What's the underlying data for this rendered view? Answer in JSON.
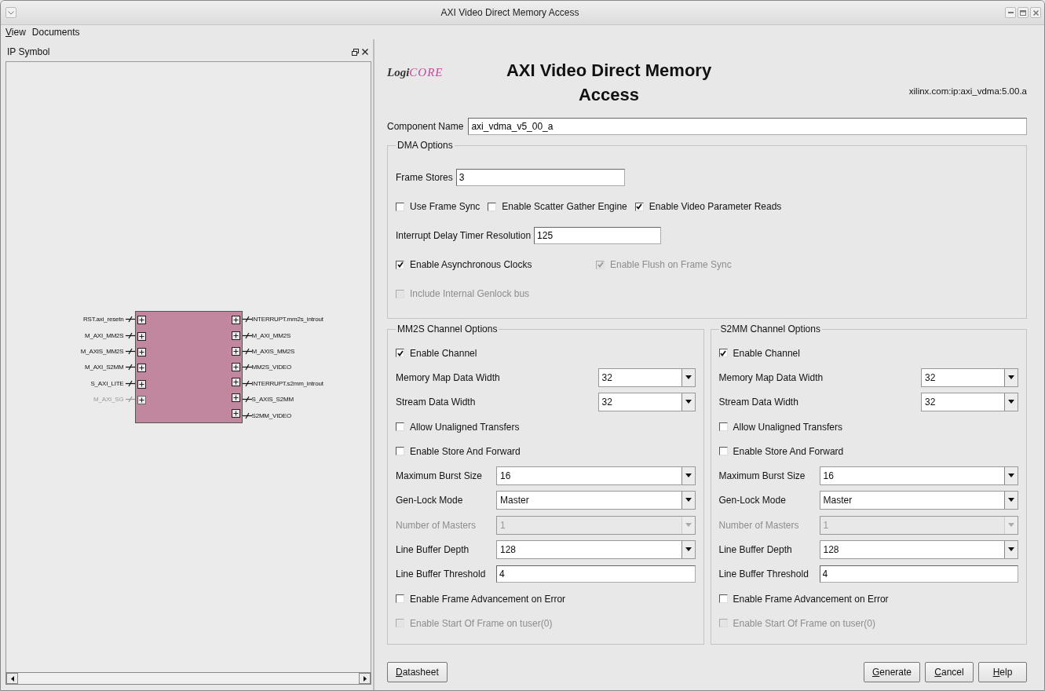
{
  "window": {
    "title": "AXI Video Direct Memory Access"
  },
  "menu": [
    {
      "label": "View",
      "mnemonic": true
    },
    {
      "label": "Documents",
      "mnemonic": false
    }
  ],
  "symbol_panel": {
    "title": "IP Symbol",
    "left_ports": [
      {
        "name": "RST.axi_resetn",
        "disabled": false
      },
      {
        "name": "M_AXI_MM2S",
        "disabled": false
      },
      {
        "name": "M_AXIS_MM2S",
        "disabled": false
      },
      {
        "name": "M_AXI_S2MM",
        "disabled": false
      },
      {
        "name": "S_AXI_LITE",
        "disabled": false
      },
      {
        "name": "M_AXI_SG",
        "disabled": true
      }
    ],
    "right_ports": [
      {
        "name": "INTERRUPT.mm2s_introut",
        "disabled": false
      },
      {
        "name": "M_AXI_MM2S",
        "disabled": false
      },
      {
        "name": "M_AXIS_MM2S",
        "disabled": false
      },
      {
        "name": "MM2S_VIDEO",
        "disabled": false
      },
      {
        "name": "INTERRUPT.s2mm_introut",
        "disabled": false
      },
      {
        "name": "S_AXIS_S2MM",
        "disabled": false
      },
      {
        "name": "S2MM_VIDEO",
        "disabled": false
      }
    ]
  },
  "header": {
    "logo": [
      "Logi",
      "CORE"
    ],
    "title": "AXI Video Direct Memory Access",
    "version": "xilinx.com:ip:axi_vdma:5.00.a"
  },
  "component_name": {
    "label": "Component Name",
    "value": "axi_vdma_v5_00_a"
  },
  "dma_options": {
    "title": "DMA Options",
    "rows": [
      [
        {
          "kind": "field",
          "label": "Frame Stores",
          "value": "3",
          "disabled": false
        }
      ],
      [
        {
          "kind": "checkbox",
          "label": "Use Frame Sync",
          "checked": false,
          "disabled": false
        },
        {
          "kind": "checkbox",
          "label": "Enable Scatter Gather Engine",
          "checked": false,
          "disabled": false
        },
        {
          "kind": "checkbox",
          "label": "Enable Video Parameter Reads",
          "checked": true,
          "disabled": false
        }
      ],
      [
        {
          "kind": "field",
          "label": "Interrupt Delay Timer Resolution",
          "value": "125",
          "disabled": false
        }
      ],
      [
        {
          "kind": "checkbox",
          "label": "Enable Asynchronous Clocks",
          "checked": true,
          "disabled": false
        },
        {
          "kind": "checkbox",
          "label": "Enable Flush on Frame Sync",
          "checked": true,
          "disabled": true
        }
      ],
      [
        {
          "kind": "checkbox",
          "label": "Include Internal Genlock bus",
          "checked": false,
          "disabled": true
        }
      ]
    ]
  },
  "channels": [
    {
      "title": "MM2S Channel Options",
      "rows": [
        {
          "kind": "checkbox",
          "label": "Enable Channel",
          "checked": true,
          "disabled": false
        },
        {
          "kind": "narrowselect",
          "label": "Memory Map Data Width",
          "value": "32",
          "disabled": false
        },
        {
          "kind": "narrowselect",
          "label": "Stream Data Width",
          "value": "32",
          "disabled": false
        },
        {
          "kind": "checkbox",
          "label": "Allow Unaligned Transfers",
          "checked": false,
          "disabled": false
        },
        {
          "kind": "checkbox",
          "label": "Enable Store And Forward",
          "checked": false,
          "disabled": false
        },
        {
          "kind": "select",
          "label": "Maximum Burst Size",
          "value": "16",
          "disabled": false
        },
        {
          "kind": "select",
          "label": "Gen-Lock Mode",
          "value": "Master",
          "disabled": false
        },
        {
          "kind": "select",
          "label": "Number of Masters",
          "value": "1",
          "disabled": true
        },
        {
          "kind": "select",
          "label": "Line Buffer Depth",
          "value": "128",
          "disabled": false
        },
        {
          "kind": "field",
          "label": "Line Buffer Threshold",
          "value": "4",
          "disabled": false
        },
        {
          "kind": "checkbox",
          "label": "Enable Frame Advancement on Error",
          "checked": false,
          "disabled": false
        },
        {
          "kind": "checkbox",
          "label": "Enable Start Of Frame on tuser(0)",
          "checked": false,
          "disabled": true
        }
      ]
    },
    {
      "title": "S2MM Channel Options",
      "rows": [
        {
          "kind": "checkbox",
          "label": "Enable Channel",
          "checked": true,
          "disabled": false
        },
        {
          "kind": "narrowselect",
          "label": "Memory Map Data Width",
          "value": "32",
          "disabled": false
        },
        {
          "kind": "narrowselect",
          "label": "Stream Data Width",
          "value": "32",
          "disabled": false
        },
        {
          "kind": "checkbox",
          "label": "Allow Unaligned Transfers",
          "checked": false,
          "disabled": false
        },
        {
          "kind": "checkbox",
          "label": "Enable Store And Forward",
          "checked": false,
          "disabled": false
        },
        {
          "kind": "select",
          "label": "Maximum Burst Size",
          "value": "16",
          "disabled": false
        },
        {
          "kind": "select",
          "label": "Gen-Lock Mode",
          "value": "Master",
          "disabled": false
        },
        {
          "kind": "select",
          "label": "Number of Masters",
          "value": "1",
          "disabled": true
        },
        {
          "kind": "select",
          "label": "Line Buffer Depth",
          "value": "128",
          "disabled": false
        },
        {
          "kind": "field",
          "label": "Line Buffer Threshold",
          "value": "4",
          "disabled": false
        },
        {
          "kind": "checkbox",
          "label": "Enable Frame Advancement on Error",
          "checked": false,
          "disabled": false
        },
        {
          "kind": "checkbox",
          "label": "Enable Start Of Frame on tuser(0)",
          "checked": false,
          "disabled": true
        }
      ]
    }
  ],
  "left_buttons": [
    {
      "label": "Datasheet",
      "mnemonic": true
    }
  ],
  "right_buttons": [
    {
      "label": "Generate",
      "mnemonic": true
    },
    {
      "label": "Cancel",
      "mnemonic": true
    },
    {
      "label": "Help",
      "mnemonic": true
    }
  ]
}
